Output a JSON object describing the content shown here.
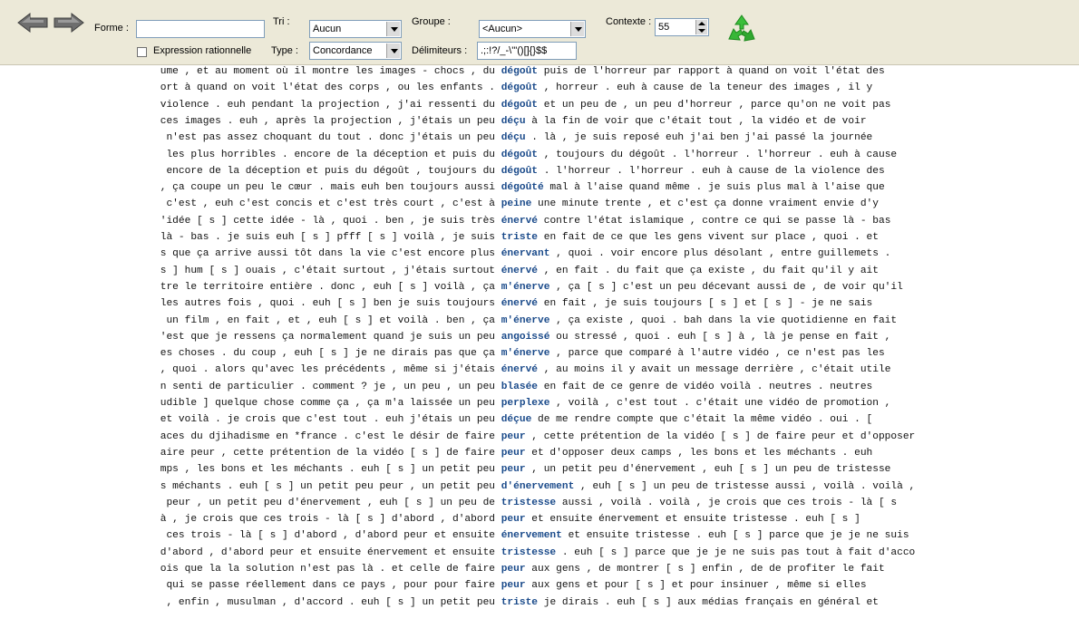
{
  "toolbar": {
    "forme_label": "Forme :",
    "forme_value": "",
    "tri_label": "Tri :",
    "tri_value": "Aucun",
    "groupe_label": "Groupe :",
    "groupe_value": "<Aucun>",
    "contexte_label": "Contexte :",
    "contexte_value": "55",
    "regex_label": "Expression rationnelle",
    "regex_checked": false,
    "type_label": "Type :",
    "type_value": "Concordance",
    "delim_label": "Délimiteurs :",
    "delim_value": ".;:!?/_-\\'\"()[]{}$$",
    "icons": {
      "back": "back-arrow-icon",
      "forward": "forward-arrow-icon",
      "refresh": "recycle-refresh-icon"
    }
  },
  "colors": {
    "toolbar_bg": "#ece9d8",
    "keyword": "#1a4a8a",
    "accent_green": "#2db32d"
  },
  "concordance": [
    {
      "left": "ume , et au moment où il montre les images - chocs , du ",
      "kw": "dégoût",
      "right": " puis de l'horreur par rapport à quand on voit l'état des"
    },
    {
      "left": "ort à quand on voit l'état des corps , ou les enfants . ",
      "kw": "dégoût",
      "right": " , horreur . euh à cause de la teneur des images , il y"
    },
    {
      "left": "violence . euh pendant la projection , j'ai ressenti du ",
      "kw": "dégoût",
      "right": " et un peu de , un peu d'horreur , parce qu'on ne voit pas"
    },
    {
      "left": "ces images . euh , après la projection , j'étais un peu ",
      "kw": "déçu",
      "right": " à la fin de voir que c'était tout , la vidéo et de voir"
    },
    {
      "left": " n'est pas assez choquant du tout . donc j'étais un peu ",
      "kw": "déçu",
      "right": " . là , je suis reposé euh j'ai ben j'ai passé la journée"
    },
    {
      "left": "  les plus horribles . encore de la déception et puis du ",
      "kw": "dégoût",
      "right": " , toujours du dégoût . l'horreur . l'horreur . euh à cause"
    },
    {
      "left": " encore de la déception et puis du dégoût , toujours du ",
      "kw": "dégoût",
      "right": " . l'horreur . l'horreur . euh à cause de la violence des"
    },
    {
      "left": ", ça coupe un peu le cœur . mais euh ben toujours aussi ",
      "kw": "dégoûté",
      "right": " mal à l'aise quand même . je suis plus mal à l'aise que"
    },
    {
      "left": "  c'est , euh c'est concis et c'est très court , c'est à ",
      "kw": "peine",
      "right": " une minute trente , et c'est ça donne vraiment envie d'y"
    },
    {
      "left": "'idée [ s ] cette idée - là , quoi . ben , je suis très ",
      "kw": "énervé",
      "right": " contre l'état islamique , contre ce qui se passe là - bas"
    },
    {
      "left": "là - bas . je suis euh [ s ] pfff [ s ] voilà , je suis ",
      "kw": "triste",
      "right": " en fait de ce que les gens vivent sur place , quoi . et"
    },
    {
      "left": "s que ça arrive aussi tôt dans la vie c'est encore plus ",
      "kw": "énervant",
      "right": " , quoi . voir encore plus désolant , entre guillemets ."
    },
    {
      "left": "s ] hum [ s ] ouais , c'était surtout , j'étais surtout ",
      "kw": "énervé",
      "right": " , en fait . du fait que ça existe , du fait qu'il y ait"
    },
    {
      "left": "tre le territoire entière . donc , euh [ s ] voilà , ça ",
      "kw": "m'énerve",
      "right": " , ça [ s ] c'est un peu décevant aussi de , de voir qu'il"
    },
    {
      "left": "les autres fois , quoi . euh [ s ] ben je suis toujours ",
      "kw": "énervé",
      "right": " en fait , je suis toujours [ s ] et [ s ] - je ne sais"
    },
    {
      "left": " un film , en fait , et , euh [ s ] et voilà . ben , ça ",
      "kw": "m'énerve",
      "right": " , ça existe , quoi . bah dans la vie quotidienne en fait"
    },
    {
      "left": "'est que je ressens ça normalement quand je suis un peu ",
      "kw": "angoissé",
      "right": " ou stressé , quoi . euh [ s ] à , là je pense en fait ,"
    },
    {
      "left": "es choses . du coup , euh [ s ] je ne dirais pas que ça ",
      "kw": "m'énerve",
      "right": " , parce que comparé à l'autre vidéo , ce n'est pas les"
    },
    {
      "left": ", quoi . alors qu'avec les précédents , même si j'étais ",
      "kw": "énervé",
      "right": " , au moins il y avait un message derrière , c'était utile"
    },
    {
      "left": "n senti de particulier . comment ? je , un peu , un peu ",
      "kw": "blasée",
      "right": " en fait de ce genre de vidéo voilà . neutres . neutres"
    },
    {
      "left": "udible ] quelque chose comme ça , ça m'a laissée un peu ",
      "kw": "perplexe",
      "right": " , voilà , c'est tout . c'était une vidéo de promotion ,"
    },
    {
      "left": "et voilà . je crois que c'est tout . euh j'étais un peu ",
      "kw": "déçue",
      "right": " de me rendre compte que c'était la même vidéo . oui . ["
    },
    {
      "left": "aces du djihadisme en *france . c'est le désir de faire ",
      "kw": "peur",
      "right": " , cette prétention de la vidéo [ s ] de faire peur et d'opposer"
    },
    {
      "left": "aire peur , cette prétention de la vidéo [ s ] de faire ",
      "kw": "peur",
      "right": " et d'opposer deux camps , les bons et les méchants . euh"
    },
    {
      "left": "mps , les bons et les méchants . euh [ s ] un petit peu ",
      "kw": "peur",
      "right": " , un petit peu d'énervement , euh [ s ] un peu de tristesse"
    },
    {
      "left": "s méchants . euh [ s ] un petit peu peur , un petit peu ",
      "kw": "d'énervement",
      "right": " , euh [ s ] un peu de tristesse aussi , voilà . voilà ,"
    },
    {
      "left": " peur , un petit peu d'énervement , euh [ s ] un peu de ",
      "kw": "tristesse",
      "right": " aussi , voilà . voilà , je crois que ces trois - là [ s"
    },
    {
      "left": "à , je crois que ces trois - là [ s ] d'abord , d'abord ",
      "kw": "peur",
      "right": " et ensuite énervement et ensuite tristesse . euh [ s ]"
    },
    {
      "left": " ces trois - là [ s ] d'abord , d'abord peur et ensuite ",
      "kw": "énervement",
      "right": " et ensuite tristesse . euh [ s ] parce que je je ne suis"
    },
    {
      "left": "d'abord , d'abord peur et ensuite énervement et ensuite ",
      "kw": "tristesse",
      "right": " . euh [ s ] parce que je je ne suis pas tout à fait d'acco"
    },
    {
      "left": "ois que la la solution n'est pas là . et celle de faire ",
      "kw": "peur",
      "right": " aux gens , de montrer [ s ] enfin , de de profiter le fait"
    },
    {
      "left": " qui se passe réellement dans ce pays , pour pour faire ",
      "kw": "peur",
      "right": " aux gens et pour [ s ] et pour insinuer , même si elles"
    },
    {
      "left": ", enfin , musulman , d'accord . euh [ s ] un petit peu ",
      "kw": "triste",
      "right": " je dirais . euh [ s ] aux médias français en général et"
    }
  ]
}
